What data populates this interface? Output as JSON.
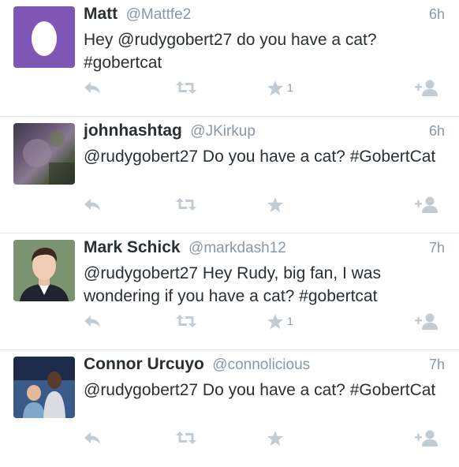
{
  "colors": {
    "name": "#292f33",
    "muted": "#8899a6",
    "divider": "#e1e8ed",
    "icon": "#c3ccd3"
  },
  "tweets": [
    {
      "name": "Matt",
      "handle": "@Mattfe2",
      "time": "6h",
      "text": "Hey @rudygobert27 do you have a cat? #gobertcat",
      "favorites": "1",
      "avatar": "egg-avatar"
    },
    {
      "name": "johnhashtag",
      "handle": "@JKirkup",
      "time": "6h",
      "text": "@rudygobert27 Do you have a cat? #GobertCat",
      "favorites": "",
      "avatar": "photo-avatar"
    },
    {
      "name": "Mark Schick",
      "handle": "@markdash12",
      "time": "7h",
      "text": "@rudygobert27 Hey Rudy, big fan, I was wondering if you have a cat? #gobertcat",
      "favorites": "1",
      "avatar": "photo-avatar"
    },
    {
      "name": "Connor Urcuyo",
      "handle": "@connolicious",
      "time": "7h",
      "text": "@rudygobert27 Do you have a cat? #GobertCat",
      "favorites": "",
      "avatar": "photo-avatar"
    }
  ],
  "icons": [
    "reply-icon",
    "retweet-icon",
    "favorite-icon",
    "follow-icon"
  ]
}
